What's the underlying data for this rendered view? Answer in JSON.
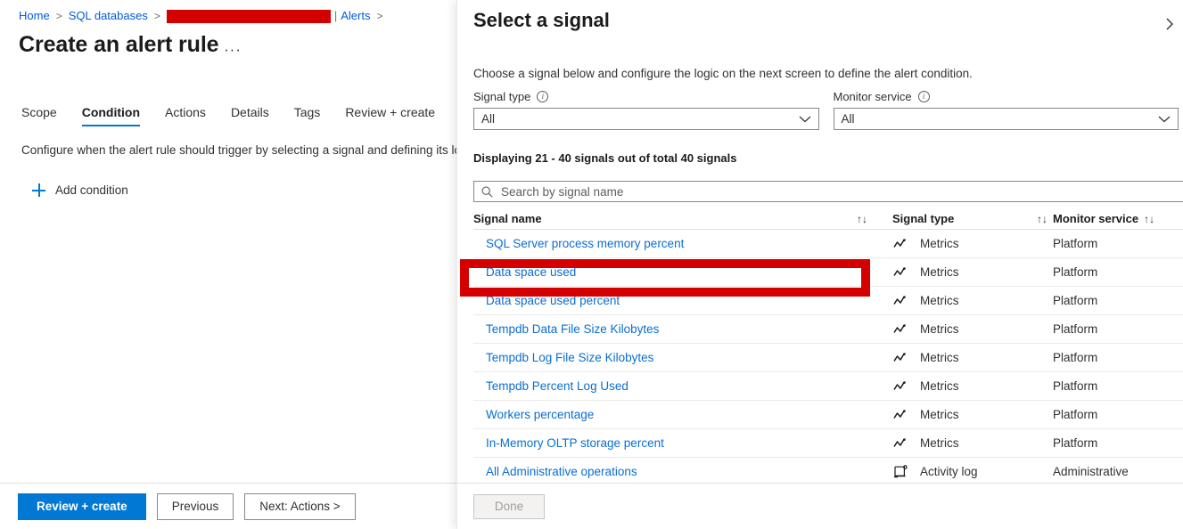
{
  "left_pane": {
    "breadcrumb": {
      "home": "Home",
      "sql_databases": "SQL databases",
      "redacted_resource": "",
      "alerts": "Alerts",
      "separator": ">",
      "pipe": "|"
    },
    "page_title": "Create an alert rule",
    "title_ellipsis": "···",
    "tabs": [
      {
        "label": "Scope",
        "active": false
      },
      {
        "label": "Condition",
        "active": true
      },
      {
        "label": "Actions",
        "active": false
      },
      {
        "label": "Details",
        "active": false
      },
      {
        "label": "Tags",
        "active": false
      },
      {
        "label": "Review + create",
        "active": false
      }
    ],
    "description": "Configure when the alert rule should trigger by selecting a signal and defining its logic.",
    "add_condition_label": "Add condition",
    "footer_buttons": [
      {
        "label": "Review + create",
        "style": "primary",
        "disabled": false
      },
      {
        "label": "Previous",
        "style": "default",
        "disabled": false
      },
      {
        "label": "Next: Actions >",
        "style": "default",
        "disabled": false
      }
    ]
  },
  "panel": {
    "title": "Select a signal",
    "description": "Choose a signal below and configure the logic on the next screen to define the alert condition.",
    "filters": {
      "signal_type": {
        "label": "Signal type",
        "value": "All"
      },
      "monitor_service": {
        "label": "Monitor service",
        "value": "All"
      }
    },
    "count_line": "Displaying 21 - 40 signals out of total 40 signals",
    "search": {
      "placeholder": "Search by signal name",
      "value": ""
    },
    "table": {
      "headers": {
        "signal_name": "Signal name",
        "signal_type": "Signal type",
        "monitor_service": "Monitor service"
      },
      "rows": [
        {
          "name": "SQL Server process memory percent",
          "type": "Metrics",
          "service": "Platform",
          "icon": "metrics-chart-icon",
          "highlighted": false
        },
        {
          "name": "Data space used",
          "type": "Metrics",
          "service": "Platform",
          "icon": "metrics-chart-icon",
          "highlighted": true
        },
        {
          "name": "Data space used percent",
          "type": "Metrics",
          "service": "Platform",
          "icon": "metrics-chart-icon",
          "highlighted": false
        },
        {
          "name": "Tempdb Data File Size Kilobytes",
          "type": "Metrics",
          "service": "Platform",
          "icon": "metrics-chart-icon",
          "highlighted": false
        },
        {
          "name": "Tempdb Log File Size Kilobytes",
          "type": "Metrics",
          "service": "Platform",
          "icon": "metrics-chart-icon",
          "highlighted": false
        },
        {
          "name": "Tempdb Percent Log Used",
          "type": "Metrics",
          "service": "Platform",
          "icon": "metrics-chart-icon",
          "highlighted": false
        },
        {
          "name": "Workers percentage",
          "type": "Metrics",
          "service": "Platform",
          "icon": "metrics-chart-icon",
          "highlighted": false
        },
        {
          "name": "In-Memory OLTP storage percent",
          "type": "Metrics",
          "service": "Platform",
          "icon": "metrics-chart-icon",
          "highlighted": false
        },
        {
          "name": "All Administrative operations",
          "type": "Activity log",
          "service": "Administrative",
          "icon": "activity-log-scroll-icon",
          "highlighted": false
        }
      ]
    },
    "done_button": {
      "label": "Done",
      "disabled": true
    }
  },
  "colors": {
    "accent": "#0078d4",
    "link": "#0a6ed1",
    "annotation_red": "#d40000",
    "text": "#323130"
  }
}
